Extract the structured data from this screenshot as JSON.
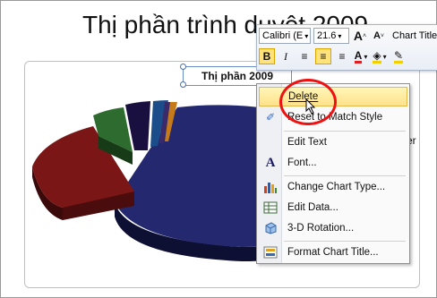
{
  "slide": {
    "title": "Thị phần trình duyệt 2009"
  },
  "chart": {
    "title": "Thị phần 2009",
    "legend_partial_text": "er"
  },
  "chart_data": {
    "type": "pie",
    "title": "Thị phần 2009",
    "series": [
      {
        "values": [
          62,
          24,
          4,
          4,
          3,
          2,
          1
        ]
      }
    ],
    "colors": [
      "#24286e",
      "#7a1616",
      "#2e6b2e",
      "#1a1040",
      "#1b4d8a",
      "#3a2a6a",
      "#c47a1a"
    ]
  },
  "mini_toolbar": {
    "font_name": "Calibri (E",
    "font_size": "21.6",
    "grow_font": "A",
    "shrink_font": "A",
    "style_label": "Chart Title",
    "bold": "B",
    "italic": "I",
    "font_color_letter": "A"
  },
  "context_menu": {
    "items": [
      {
        "label": "Delete",
        "icon": "",
        "highlighted": true
      },
      {
        "label": "Reset to Match Style",
        "icon": "reset-style-icon"
      },
      {
        "label": "Edit Text",
        "icon": ""
      },
      {
        "label": "Font...",
        "icon": "font-icon"
      },
      {
        "label": "Change Chart Type...",
        "icon": "chart-type-icon"
      },
      {
        "label": "Edit Data...",
        "icon": "edit-data-icon"
      },
      {
        "label": "3-D Rotation...",
        "icon": "rotation-icon"
      },
      {
        "label": "Format Chart Title...",
        "icon": "format-title-icon"
      }
    ]
  },
  "colors": {
    "highlight": "#ffe28a",
    "annotation_circle": "#e11111"
  }
}
